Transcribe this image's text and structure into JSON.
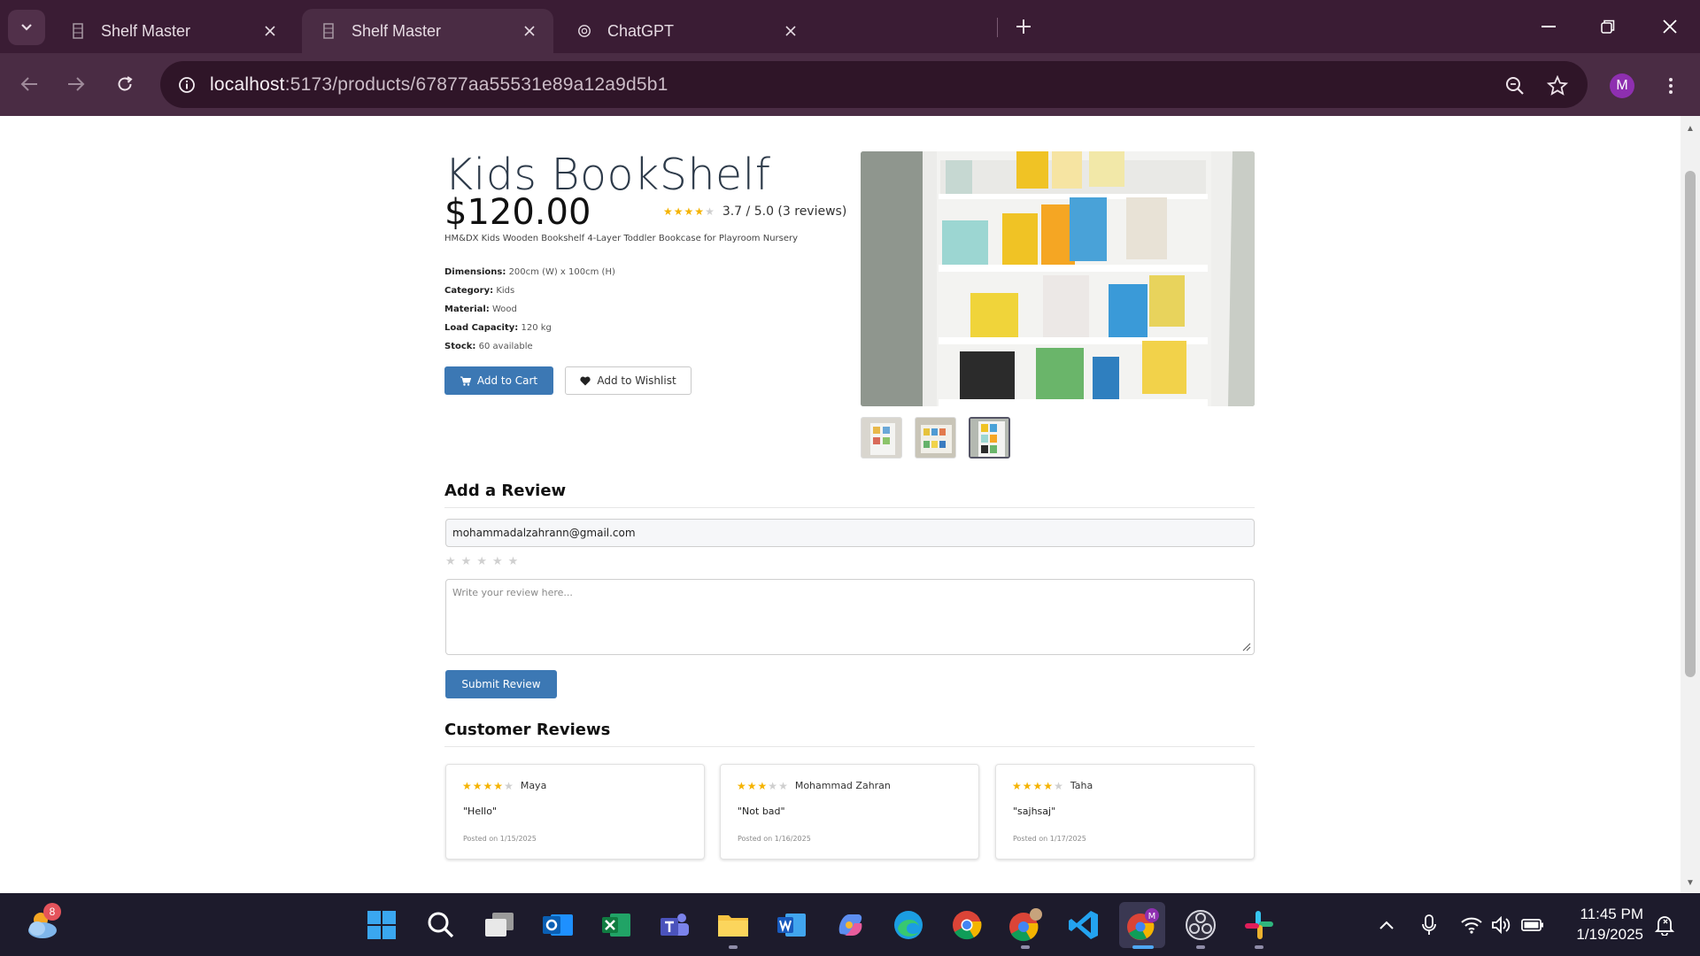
{
  "browser": {
    "tabs": [
      {
        "title": "Shelf Master",
        "active": false
      },
      {
        "title": "Shelf Master",
        "active": true
      },
      {
        "title": "ChatGPT",
        "active": false
      }
    ],
    "url_host": "localhost",
    "url_rest": ":5173/products/67877aa55531e89a12a9d5b1",
    "profile_initial": "M"
  },
  "product": {
    "title": "Kids BookShelf",
    "price": "$120.00",
    "rating_value": 3.7,
    "rating_text": "3.7 / 5.0 (3 reviews)",
    "subtitle": "HM&DX Kids Wooden Bookshelf 4-Layer Toddler Bookcase for Playroom Nursery",
    "specs": [
      {
        "label": "Dimensions:",
        "value": "200cm (W) x 100cm (H)"
      },
      {
        "label": "Category:",
        "value": "Kids"
      },
      {
        "label": "Material:",
        "value": "Wood"
      },
      {
        "label": "Load Capacity:",
        "value": "120 kg"
      },
      {
        "label": "Stock:",
        "value": "60 available"
      }
    ],
    "add_to_cart_label": "Add to Cart",
    "add_to_wishlist_label": "Add to Wishlist"
  },
  "add_review": {
    "heading": "Add a Review",
    "email_value": "mohammadalzahrann@gmail.com",
    "review_placeholder": "Write your review here...",
    "submit_label": "Submit Review"
  },
  "customer_reviews": {
    "heading": "Customer Reviews",
    "items": [
      {
        "name": "Maya",
        "rating": 4,
        "comment": "\"Hello\"",
        "date": "Posted on 1/15/2025"
      },
      {
        "name": "Mohammad Zahran",
        "rating": 3,
        "comment": "\"Not bad\"",
        "date": "Posted on 1/16/2025"
      },
      {
        "name": "Taha",
        "rating": 4,
        "comment": "\"sajhsaj\"",
        "date": "Posted on 1/17/2025"
      }
    ]
  },
  "taskbar": {
    "weather_badge": "8",
    "time": "11:45 PM",
    "date": "1/19/2025"
  },
  "colors": {
    "tabbar_bg": "#3a1c34",
    "toolbar_bg": "#4a2c44",
    "primary_button": "#3c78b4",
    "star_filled": "#f5b301",
    "taskbar_bg": "#1d1b2c"
  }
}
